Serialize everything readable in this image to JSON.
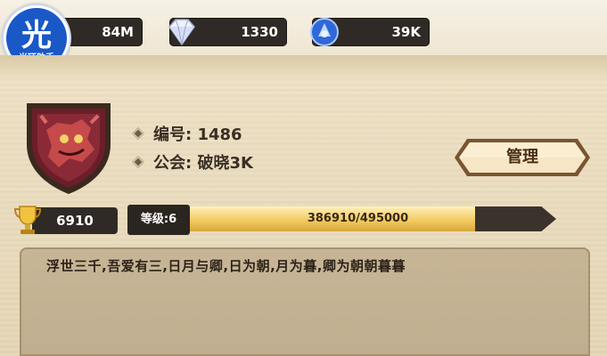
{
  "topbar": {
    "logo": {
      "char": "光",
      "caption": "光环助手"
    },
    "resources": [
      {
        "icon": "gold-icon",
        "value": "84M"
      },
      {
        "icon": "diamond-icon",
        "value": "1330"
      },
      {
        "icon": "blue-token-icon",
        "value": "39K"
      }
    ]
  },
  "guild": {
    "id_label": "编号: 1486",
    "name_label": "公会: 破晓3K",
    "manage_label": "管理",
    "trophy_value": "6910",
    "level_label": "等级:6",
    "xp_text": "386910/495000",
    "xp_current": 386910,
    "xp_max": 495000,
    "motto": "浮世三千,吾爱有三,日月与卿,日为朝,月为暮,卿为朝朝暮暮"
  }
}
